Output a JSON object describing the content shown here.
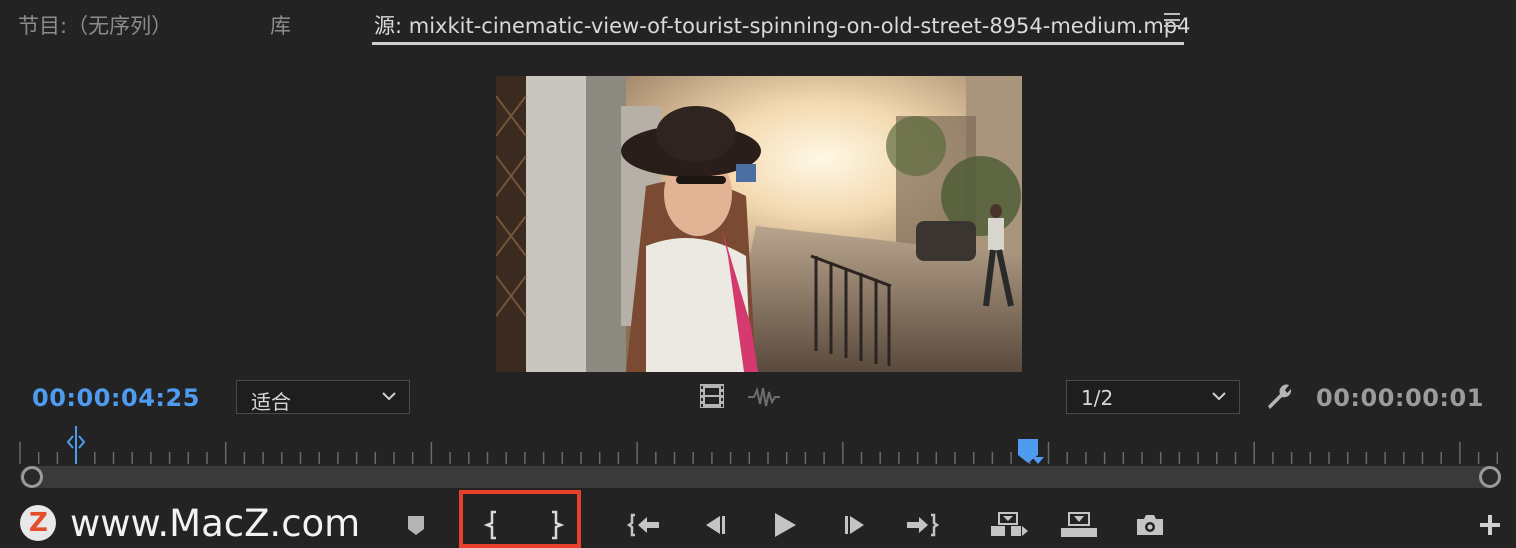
{
  "tabs": [
    {
      "label": "节目:（无序列）",
      "active": false
    },
    {
      "label": "库",
      "active": false
    },
    {
      "label": "源: mixkit-cinematic-view-of-tourist-spinning-on-old-street-8954-medium.mp4",
      "active": true
    }
  ],
  "timecode_current": "00:00:04:25",
  "timecode_duration": "00:00:00:01",
  "fit_select": {
    "value": "适合"
  },
  "resolution_select": {
    "value": "1/2"
  },
  "watermark": {
    "logo_letter": "Z",
    "text": "www.MacZ.com"
  },
  "icons": {
    "tab_menu": "hamburger-menu-icon",
    "drag_video": "film-strip-icon",
    "drag_audio": "audio-waveform-icon",
    "settings": "wrench-icon",
    "add_marker": "marker-icon",
    "mark_in": "mark-in-icon",
    "mark_out": "mark-out-icon",
    "go_to_in": "go-to-in-icon",
    "step_back": "step-back-icon",
    "play": "play-icon",
    "step_forward": "step-forward-icon",
    "go_to_out": "go-to-out-icon",
    "insert": "insert-icon",
    "overwrite": "overwrite-icon",
    "export_frame": "camera-icon",
    "button_editor": "plus-icon"
  },
  "colors": {
    "accent_blue": "#4f9bf0",
    "highlight_red": "#e8402a",
    "background": "#232323"
  }
}
